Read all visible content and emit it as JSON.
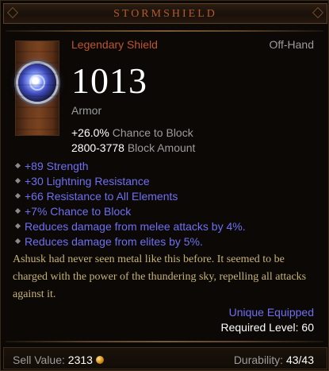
{
  "item": {
    "name": "STORMSHIELD",
    "type": "Legendary Shield",
    "slot": "Off-Hand",
    "armor_value": "1013",
    "armor_label": "Armor"
  },
  "base_stats": [
    {
      "value": "+26.0%",
      "label": "Chance to Block"
    },
    {
      "value": "2800-3778",
      "label": "Block Amount"
    }
  ],
  "affixes": [
    "+89 Strength",
    "+30 Lightning Resistance",
    "+66 Resistance to All Elements",
    "+7% Chance to Block",
    "Reduces damage from melee attacks by 4%.",
    "Reduces damage from elites by 5%."
  ],
  "flavor_text": "Ashusk had never seen metal like this before. It seemed to be charged with the power of the thundering sky, repelling all attacks against it.",
  "unique_equipped": "Unique Equipped",
  "required_level": "Required Level: 60",
  "footer": {
    "sell_label": "Sell Value:",
    "sell_value": "2313",
    "durability_label": "Durability:",
    "durability_value": "43/43"
  },
  "icons": {
    "item": "stormshield-orb-icon",
    "bullet": "diamond-bullet-icon",
    "currency": "gold-coin-icon"
  },
  "colors": {
    "legendary": "#c0562e",
    "magic_affix": "#6f6ff2",
    "flavor": "#c7b377",
    "gray_label": "#9c9c9c",
    "value_white": "#ffffff"
  }
}
